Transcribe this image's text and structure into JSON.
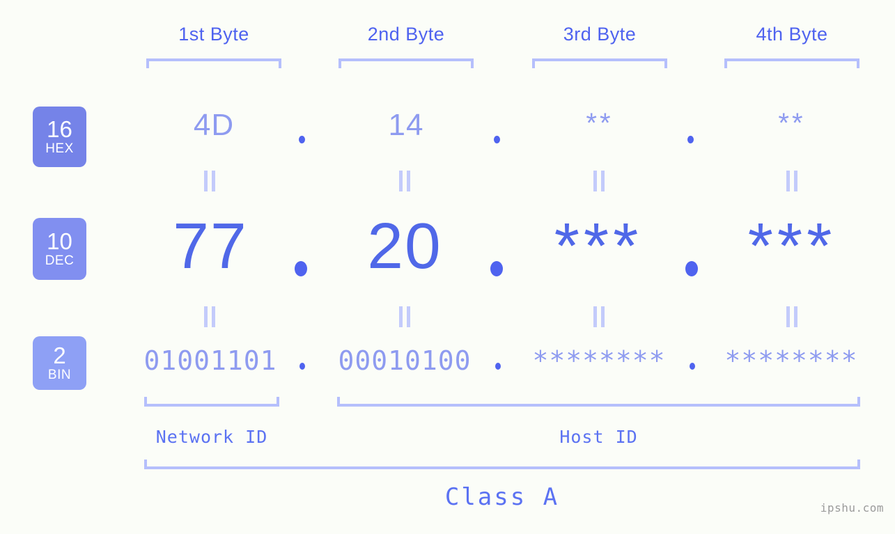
{
  "background_color": "#fbfdf8",
  "accent_colors": {
    "bracket": "#b5bffc",
    "header_text": "#4f63ef",
    "hex_value": "#8e9bf0",
    "dec_value": "#5068e8",
    "bin_value": "#8e9bf0",
    "badge_hex": "#7583e8",
    "badge_dec": "#818ff0",
    "badge_bin": "#8ea0f5",
    "caption": "#5b72f2",
    "watermark": "#9b9b9b"
  },
  "byte_headers": [
    {
      "label": "1st Byte"
    },
    {
      "label": "2nd Byte"
    },
    {
      "label": "3rd Byte"
    },
    {
      "label": "4th Byte"
    }
  ],
  "radix_badges": [
    {
      "num": "16",
      "sub": "HEX"
    },
    {
      "num": "10",
      "sub": "DEC"
    },
    {
      "num": "2",
      "sub": "BIN"
    }
  ],
  "rows": {
    "hex": {
      "values": [
        "4D",
        "14",
        "**",
        "**"
      ],
      "separator": "."
    },
    "dec": {
      "values": [
        "77",
        "20",
        "***",
        "***"
      ],
      "separator": "."
    },
    "bin": {
      "values": [
        "01001101",
        "00010100",
        "********",
        "********"
      ],
      "separator": "."
    }
  },
  "equals_mark": "||",
  "sections": {
    "network_id": "Network ID",
    "host_id": "Host ID",
    "class": "Class A"
  },
  "watermark": "ipshu.com"
}
